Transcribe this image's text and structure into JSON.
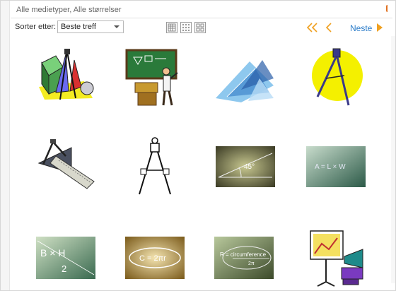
{
  "filter_bar": {
    "text": "Alle medietyper, Alle størrelser"
  },
  "sort": {
    "label": "Sorter etter:",
    "selected": "Beste treff"
  },
  "pager": {
    "next_label": "Neste"
  },
  "colors": {
    "accent": "#f0a020",
    "link": "#2b7cc9"
  },
  "results": [
    {
      "name": "geometry-shapes-compass-clipart"
    },
    {
      "name": "teacher-at-chalkboard-clipart"
    },
    {
      "name": "blue-triangles-photo"
    },
    {
      "name": "compass-on-yellow-circle-clipart"
    },
    {
      "name": "compass-and-set-squares-clipart"
    },
    {
      "name": "drawing-compass-outline-clipart"
    },
    {
      "name": "45-degree-angle-photo"
    },
    {
      "name": "l-times-w-formula-photo"
    },
    {
      "name": "b-times-h-over-2-photo"
    },
    {
      "name": "pi-formula-photo"
    },
    {
      "name": "circumference-formula-photo"
    },
    {
      "name": "presentation-projector-clipart"
    }
  ]
}
